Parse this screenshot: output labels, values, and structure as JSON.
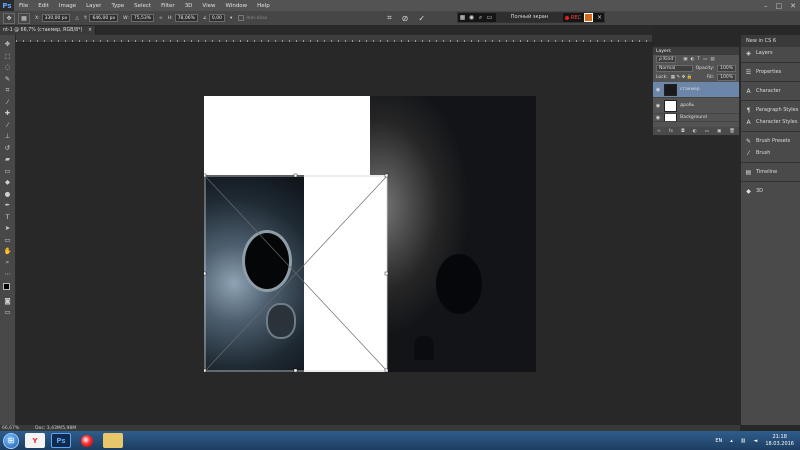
{
  "app": {
    "logo": "Ps"
  },
  "menu": [
    "File",
    "Edit",
    "Image",
    "Layer",
    "Type",
    "Select",
    "Filter",
    "3D",
    "View",
    "Window",
    "Help"
  ],
  "window_controls": [
    "–",
    "□",
    "✕"
  ],
  "options_bar": {
    "x_value": "330,00 px",
    "y_value": "646,00 px",
    "w_label": "W:",
    "w_value": "75,53%",
    "h_label": "H:",
    "h_value": "78,06%",
    "angle_value": "0,00",
    "antialias_label": "Anti-alias"
  },
  "recorder": {
    "title": "Полный экран",
    "rec_label": "REC"
  },
  "document_tab": {
    "title": "nt-1 @ 66,7% (стакмер, RGB/8*)",
    "close": "×"
  },
  "layers_panel": {
    "title": "Layers",
    "kind_label": "ρ Kind",
    "blend_mode": "Normal",
    "opacity_label": "Opacity:",
    "opacity_value": "100%",
    "lock_label": "Lock:",
    "fill_label": "Fill:",
    "fill_value": "100%",
    "layers": [
      {
        "name": "стакмер"
      },
      {
        "name": "дробь"
      },
      {
        "name": "Background"
      }
    ]
  },
  "dock": {
    "top_label": "New in CS 6",
    "items": [
      "Layers",
      "Properties",
      "Character",
      "Paragraph Styles",
      "Character Styles",
      "Brush Presets",
      "Brush",
      "Timeline",
      "3D"
    ]
  },
  "status": {
    "zoom": "66,67%",
    "doc": "Doc: 3,43M/5,98M"
  },
  "taskbar": {
    "lang": "EN",
    "time": "21:18",
    "date": "18.03.2016"
  }
}
